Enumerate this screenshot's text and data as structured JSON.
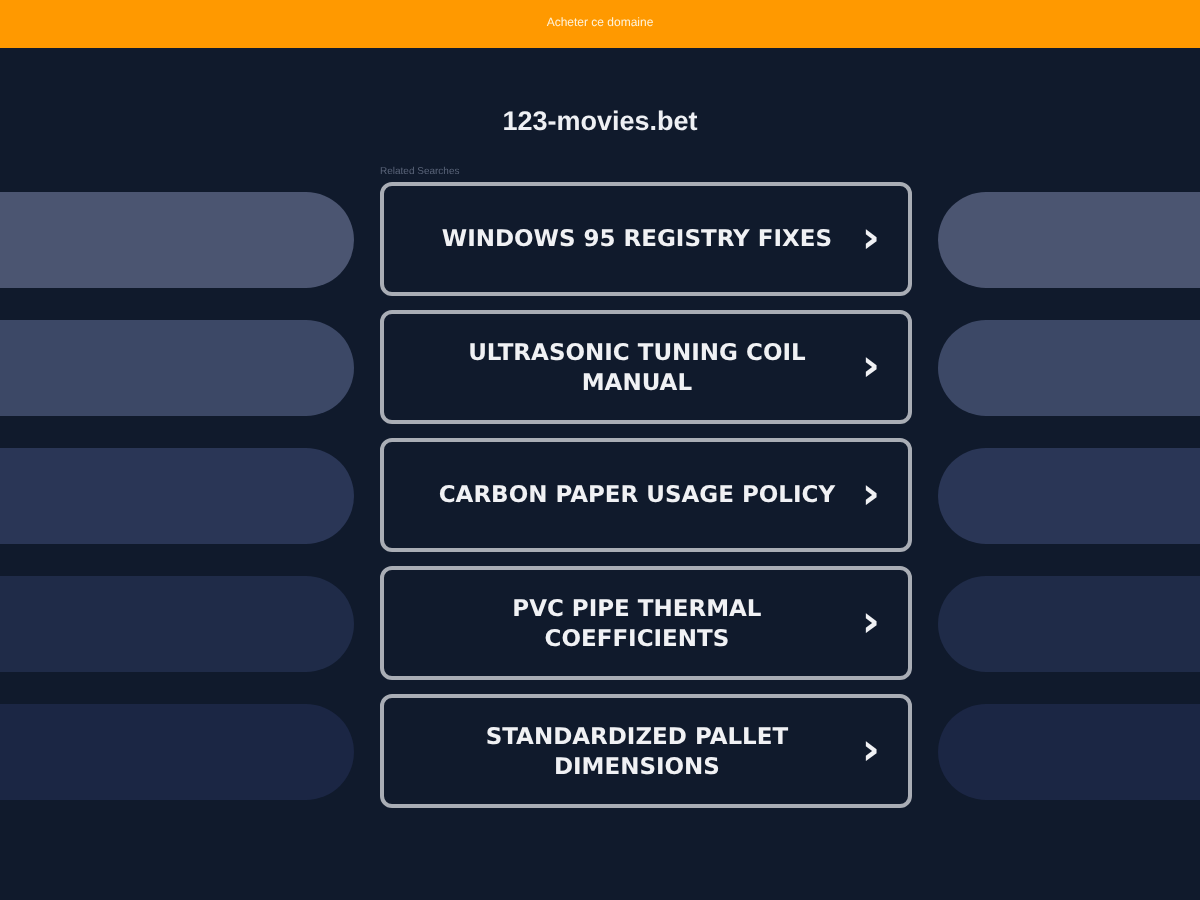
{
  "top_bar": {
    "text": "Acheter ce domaine"
  },
  "site_title": "123-movies.bet",
  "related_label": "Related Searches",
  "links": [
    {
      "label": "WINDOWS 95 REGISTRY FIXES",
      "icon": "›"
    },
    {
      "label": "ULTRASONIC TUNING COIL MANUAL",
      "icon": "›"
    },
    {
      "label": "CARBON PAPER USAGE POLICY",
      "icon": "›"
    },
    {
      "label": "PVC PIPE THERMAL COEFFICIENTS",
      "icon": "›"
    },
    {
      "label": "STANDARDIZED PALLET DIMENSIONS",
      "icon": "›"
    }
  ]
}
